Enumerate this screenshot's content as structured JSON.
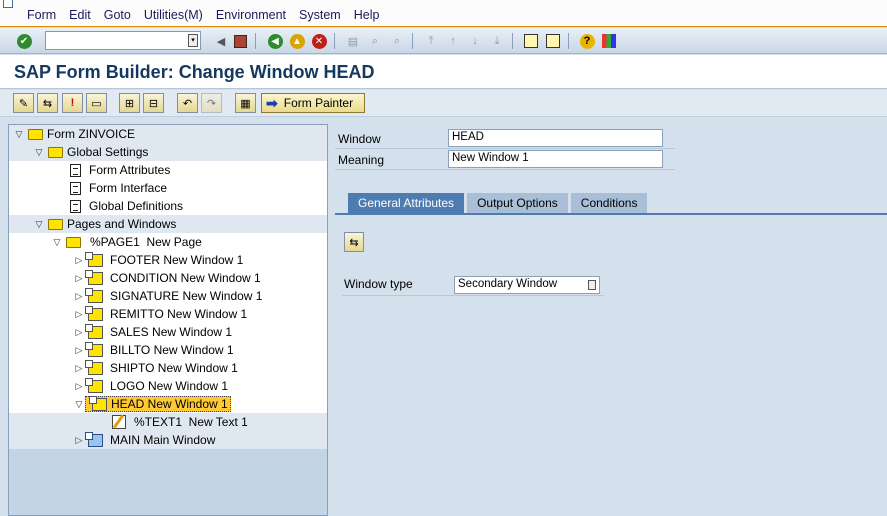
{
  "menu": [
    "Form",
    "Edit",
    "Goto",
    "Utilities(M)",
    "Environment",
    "System",
    "Help"
  ],
  "title": "SAP Form Builder: Change Window HEAD",
  "app_toolbar": {
    "form_painter_label": "Form Painter"
  },
  "tree": {
    "root": "Form ZINVOICE",
    "global_settings": "Global Settings",
    "gs_items": [
      "Form Attributes",
      "Form Interface",
      "Global Definitions"
    ],
    "pages_windows": "Pages and Windows",
    "page": "%PAGE1  New Page",
    "windows": [
      "FOOTER New Window 1",
      "CONDITION New Window 1",
      "SIGNATURE New Window 1",
      "REMITTO New Window 1",
      "SALES New Window 1",
      "BILLTO New Window 1",
      "SHIPTO New Window 1",
      "LOGO New Window 1"
    ],
    "selected": "HEAD New Window 1",
    "text_node": "%TEXT1  New Text 1",
    "main": "MAIN Main Window"
  },
  "detail": {
    "window_label": "Window",
    "window_value": "HEAD",
    "meaning_label": "Meaning",
    "meaning_value": "New Window 1",
    "tabs": [
      "General Attributes",
      "Output Options",
      "Conditions"
    ],
    "window_type_label": "Window type",
    "window_type_value": "Secondary Window"
  }
}
